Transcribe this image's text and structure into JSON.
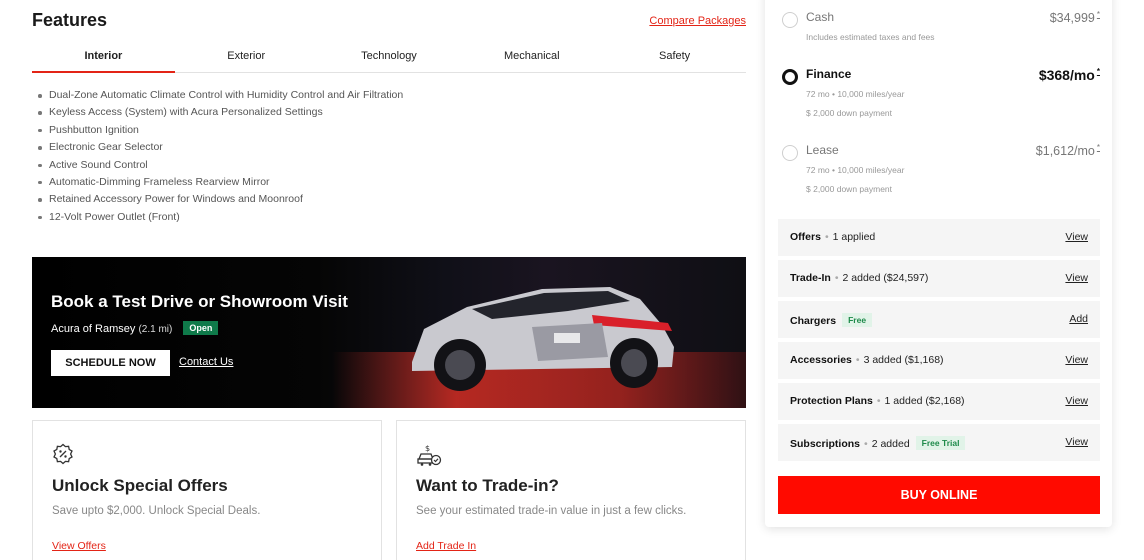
{
  "features": {
    "title": "Features",
    "compare_link": "Compare Packages",
    "tabs": [
      "Interior",
      "Exterior",
      "Technology",
      "Mechanical",
      "Safety"
    ],
    "active_tab": "Interior",
    "items": [
      "Dual-Zone Automatic Climate Control with Humidity Control and Air Filtration",
      "Keyless Access (System) with Acura Personalized Settings",
      "Pushbutton Ignition",
      "Electronic Gear Selector",
      "Active Sound Control",
      "Automatic-Dimming Frameless Rearview Mirror",
      "Retained Accessory Power for Windows and Moonroof",
      "12-Volt Power Outlet (Front)"
    ]
  },
  "test_drive": {
    "title": "Book a Test Drive or Showroom Visit",
    "dealer": "Acura of Ramsey",
    "distance": "(2.1 mi)",
    "status": "Open",
    "schedule_button": "SCHEDULE NOW",
    "contact_link": "Contact Us"
  },
  "cards": [
    {
      "icon": "percent-badge-icon",
      "title": "Unlock Special Offers",
      "text": "Save upto $2,000. Unlock Special Deals.",
      "link": "View Offers"
    },
    {
      "icon": "car-trade-in-icon",
      "title": "Want to Trade-in?",
      "text": "See your estimated trade-in value in just a few clicks.",
      "link": "Add Trade In"
    }
  ],
  "payment": {
    "options": [
      {
        "name": "Cash",
        "price": "$34,999",
        "note": "*",
        "details": [
          "Includes estimated taxes and fees"
        ],
        "selected": false
      },
      {
        "name": "Finance",
        "price": "$368/mo",
        "note": "*",
        "details": [
          "72 mo • 10,000 miles/year",
          "$ 2,000 down payment"
        ],
        "selected": true
      },
      {
        "name": "Lease",
        "price": "$1,612/mo",
        "note": "*",
        "details": [
          "72 mo • 10,000 miles/year",
          "$ 2,000 down payment"
        ],
        "selected": false
      }
    ],
    "rows": [
      {
        "label": "Offers",
        "detail": "1 applied",
        "badge": "",
        "action": "View"
      },
      {
        "label": "Trade-In",
        "detail": "2 added ($24,597)",
        "badge": "",
        "action": "View"
      },
      {
        "label": "Chargers",
        "detail": "",
        "badge": "Free",
        "action": "Add"
      },
      {
        "label": "Accessories",
        "detail": "3 added ($1,168)",
        "badge": "",
        "action": "View"
      },
      {
        "label": "Protection Plans",
        "detail": "1 added ($2,168)",
        "badge": "",
        "action": "View"
      },
      {
        "label": "Subscriptions",
        "detail": "2 added",
        "badge": "Free Trial",
        "action": "View"
      }
    ],
    "buy_button": "BUY ONLINE"
  },
  "colors": {
    "accent": "#e32416",
    "buy": "#ff0a00",
    "open_badge": "#0f7a4a",
    "free_badge_text": "#1e8a4a"
  }
}
